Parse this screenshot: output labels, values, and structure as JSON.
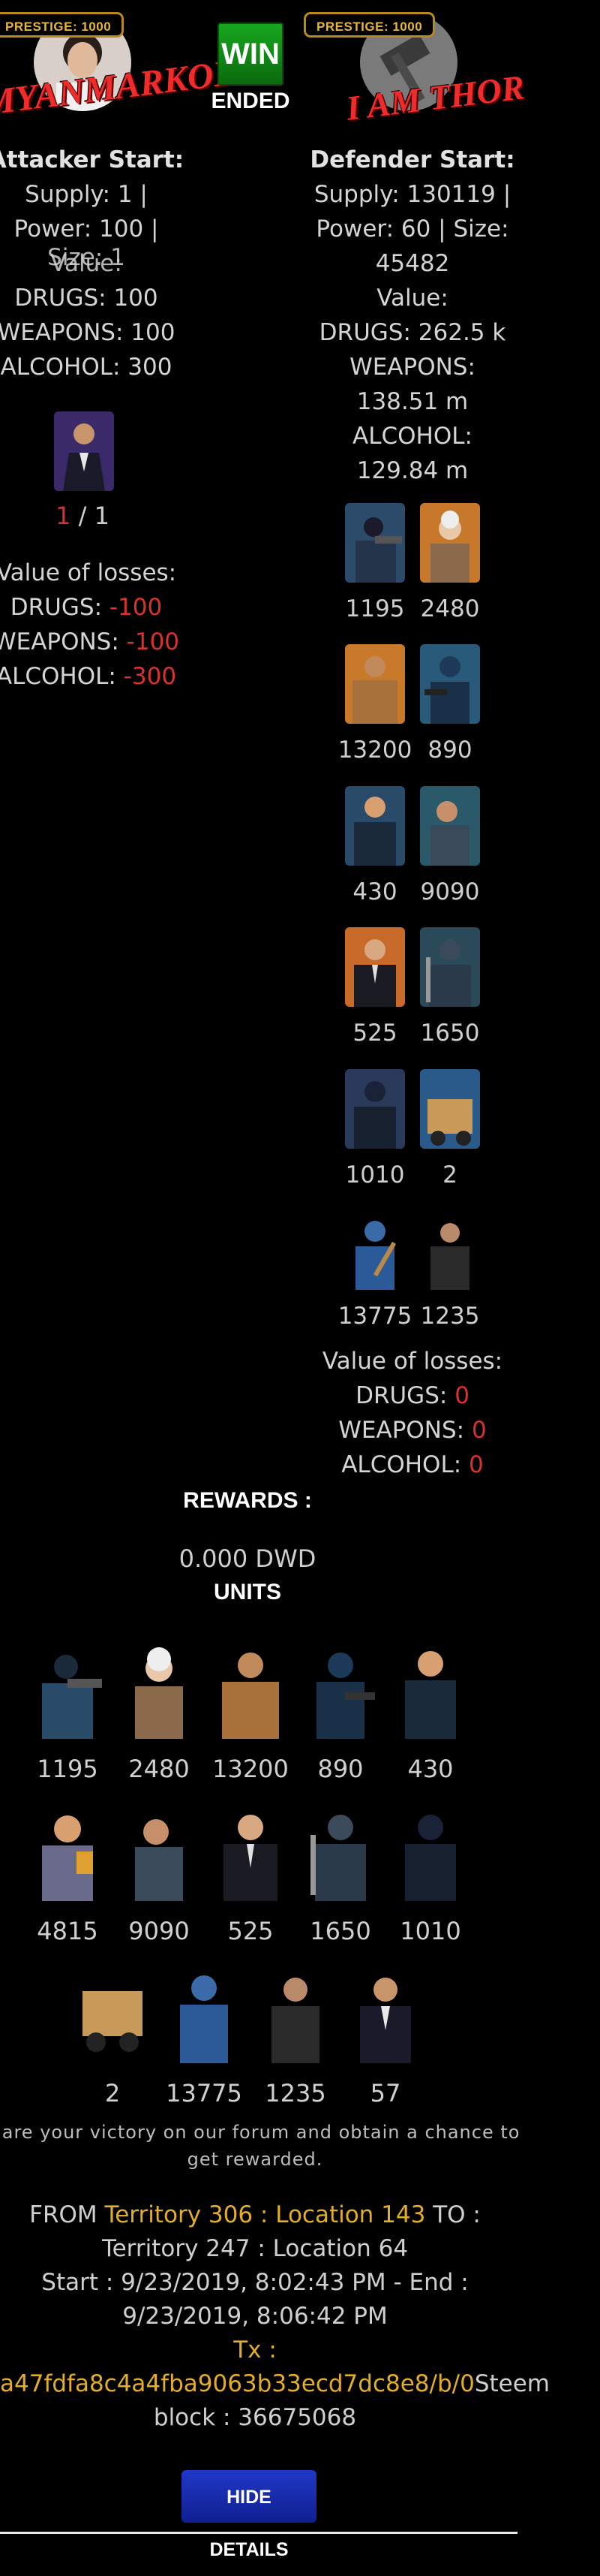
{
  "attacker": {
    "prestige_label": "PRESTIGE: 1000",
    "name": "MYANMARKOKO",
    "start_heading": "Attacker Start:",
    "supply": "Supply: 1 |",
    "power": "Power: 100 |",
    "size_overlap_a": "Size: 1",
    "size_overlap_b": "Value:",
    "drugs": "DRUGS: 100",
    "weapons": "WEAPONS: 100",
    "alcohol": "ALCOHOL: 300",
    "units_remaining": "1",
    "units_total": "/ 1",
    "losses_heading": "Value of losses:",
    "loss_drugs_label": "DRUGS:",
    "loss_drugs": "-100",
    "loss_weapons_label": "WEAPONS:",
    "loss_weapons": "-100",
    "loss_alcohol_label": "ALCOHOL:",
    "loss_alcohol": "-300"
  },
  "result": {
    "status": "WIN",
    "state": "ENDED"
  },
  "defender": {
    "prestige_label": "PRESTIGE: 1000",
    "name": "I AM THOR",
    "start_heading": "Defender Start:",
    "supply": "Supply: 130119 |",
    "power": "Power: 60 | Size:",
    "size": "45482",
    "value_label": "Value:",
    "drugs": "DRUGS: 262.5 k",
    "weapons_label": "WEAPONS:",
    "weapons": "138.51 m",
    "alcohol_label": "ALCOHOL:",
    "alcohol": "129.84 m",
    "units": [
      "1195",
      "2480",
      "13200",
      "890",
      "430",
      "9090",
      "525",
      "1650",
      "1010",
      "2",
      "13775",
      "1235"
    ],
    "losses_heading": "Value of losses:",
    "loss_drugs_label": "DRUGS:",
    "loss_drugs": "0",
    "loss_weapons_label": "WEAPONS:",
    "loss_weapons": "0",
    "loss_alcohol_label": "ALCOHOL:",
    "loss_alcohol": "0"
  },
  "rewards": {
    "heading": "REWARDS :",
    "amount": "0.000 DWD",
    "units_heading": "UNITS",
    "units": [
      "1195",
      "2480",
      "13200",
      "890",
      "430",
      "4815",
      "9090",
      "525",
      "1650",
      "1010",
      "2",
      "13775",
      "1235",
      "57"
    ]
  },
  "share_text_line1": "hare your victory on our forum and obtain a chance to",
  "share_text_line2": "get rewarded.",
  "details": {
    "from_label": "FROM",
    "from_value": "Territory 306 : Location 143",
    "to_label": "TO :",
    "to_value": "Territory 247 : Location 64",
    "start_end": "Start : 9/23/2019, 8:02:43 PM - End :",
    "end_time": "9/23/2019, 8:06:42 PM",
    "tx_label": "Tx :",
    "tx_value": "a47fdfa8c4a4fba9063b33ecd7dc8e8/b/0",
    "tx_suffix": "Steem",
    "block": "block : 36675068"
  },
  "hide_button": "HIDE DETAILS",
  "colors": {
    "win": "#129a18",
    "loss_red": "#d6322f",
    "gold": "#e2ad2a",
    "button_blue": "#1a2fb8"
  }
}
